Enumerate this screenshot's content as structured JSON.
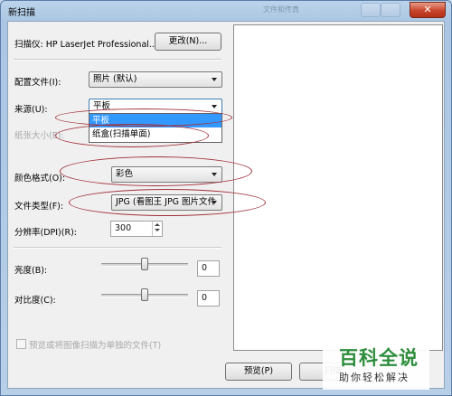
{
  "window": {
    "title": "新扫描",
    "background_title": "文件和传真"
  },
  "titlebar": {
    "close_glyph": "✕"
  },
  "scanner": {
    "label": "扫描仪: HP LaserJet Professional...",
    "change_button": "更改(N)..."
  },
  "profile": {
    "label": "配置文件(I):",
    "value": "照片 (默认)"
  },
  "source": {
    "label": "来源(U):",
    "value": "平板",
    "options": [
      "平板",
      "纸盒(扫描单面)"
    ],
    "highlighted_index": 0
  },
  "paper_size": {
    "label": "纸张大小(E):"
  },
  "color_format": {
    "label": "颜色格式(O):",
    "value": "彩色"
  },
  "file_type": {
    "label": "文件类型(F):",
    "value": "JPG (看图王 JPG 图片文件"
  },
  "resolution": {
    "label": "分辨率(DPI)(R):",
    "value": "300"
  },
  "brightness": {
    "label": "亮度(B):",
    "value": "0",
    "level_fraction": 0.5
  },
  "contrast": {
    "label": "对比度(C):",
    "value": "0",
    "level_fraction": 0.5
  },
  "separate_files": {
    "label": "预览或将图像扫描为单独的文件(T)",
    "checked": false,
    "enabled": false
  },
  "buttons": {
    "preview": "预览(P)",
    "scan": "扫描"
  },
  "watermark": {
    "brand": "百科全说",
    "slogan": "助你轻松解决"
  },
  "colors": {
    "annotation": "#a2303a",
    "dropdown_highlight": "#3399ff",
    "watermark_green": "#2d8d3c"
  }
}
